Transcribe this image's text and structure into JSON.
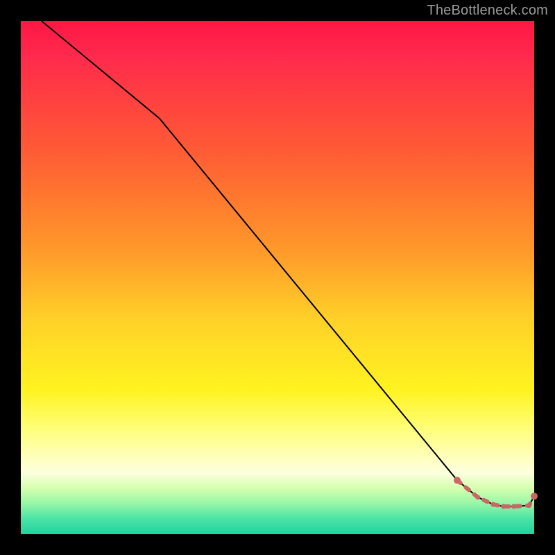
{
  "watermark": {
    "text": "TheBottleneck.com"
  },
  "chart_data": {
    "type": "line",
    "title": "",
    "xlabel": "",
    "ylabel": "",
    "xlim": [
      0,
      100
    ],
    "ylim": [
      0,
      100
    ],
    "grid": false,
    "legend": false,
    "series": [
      {
        "name": "curve",
        "x": [
          4,
          27,
          85,
          89,
          92,
          94,
          96,
          99,
          100
        ],
        "y": [
          100,
          81,
          10.5,
          7.2,
          5.8,
          5.4,
          5.4,
          5.6,
          7.4
        ]
      }
    ],
    "markers": {
      "name": "highlight-dots",
      "color": "#cc6666",
      "x": [
        85,
        89,
        92,
        94,
        96,
        99,
        100
      ],
      "y": [
        10.5,
        7.2,
        5.8,
        5.4,
        5.4,
        5.6,
        7.4
      ]
    },
    "dashed_segment": {
      "name": "highlight-dash",
      "color": "#cc6666",
      "from_index": 0,
      "to_index": 6
    },
    "background_gradient": {
      "top": "#ff1744",
      "bottom": "#1fd39d"
    }
  }
}
